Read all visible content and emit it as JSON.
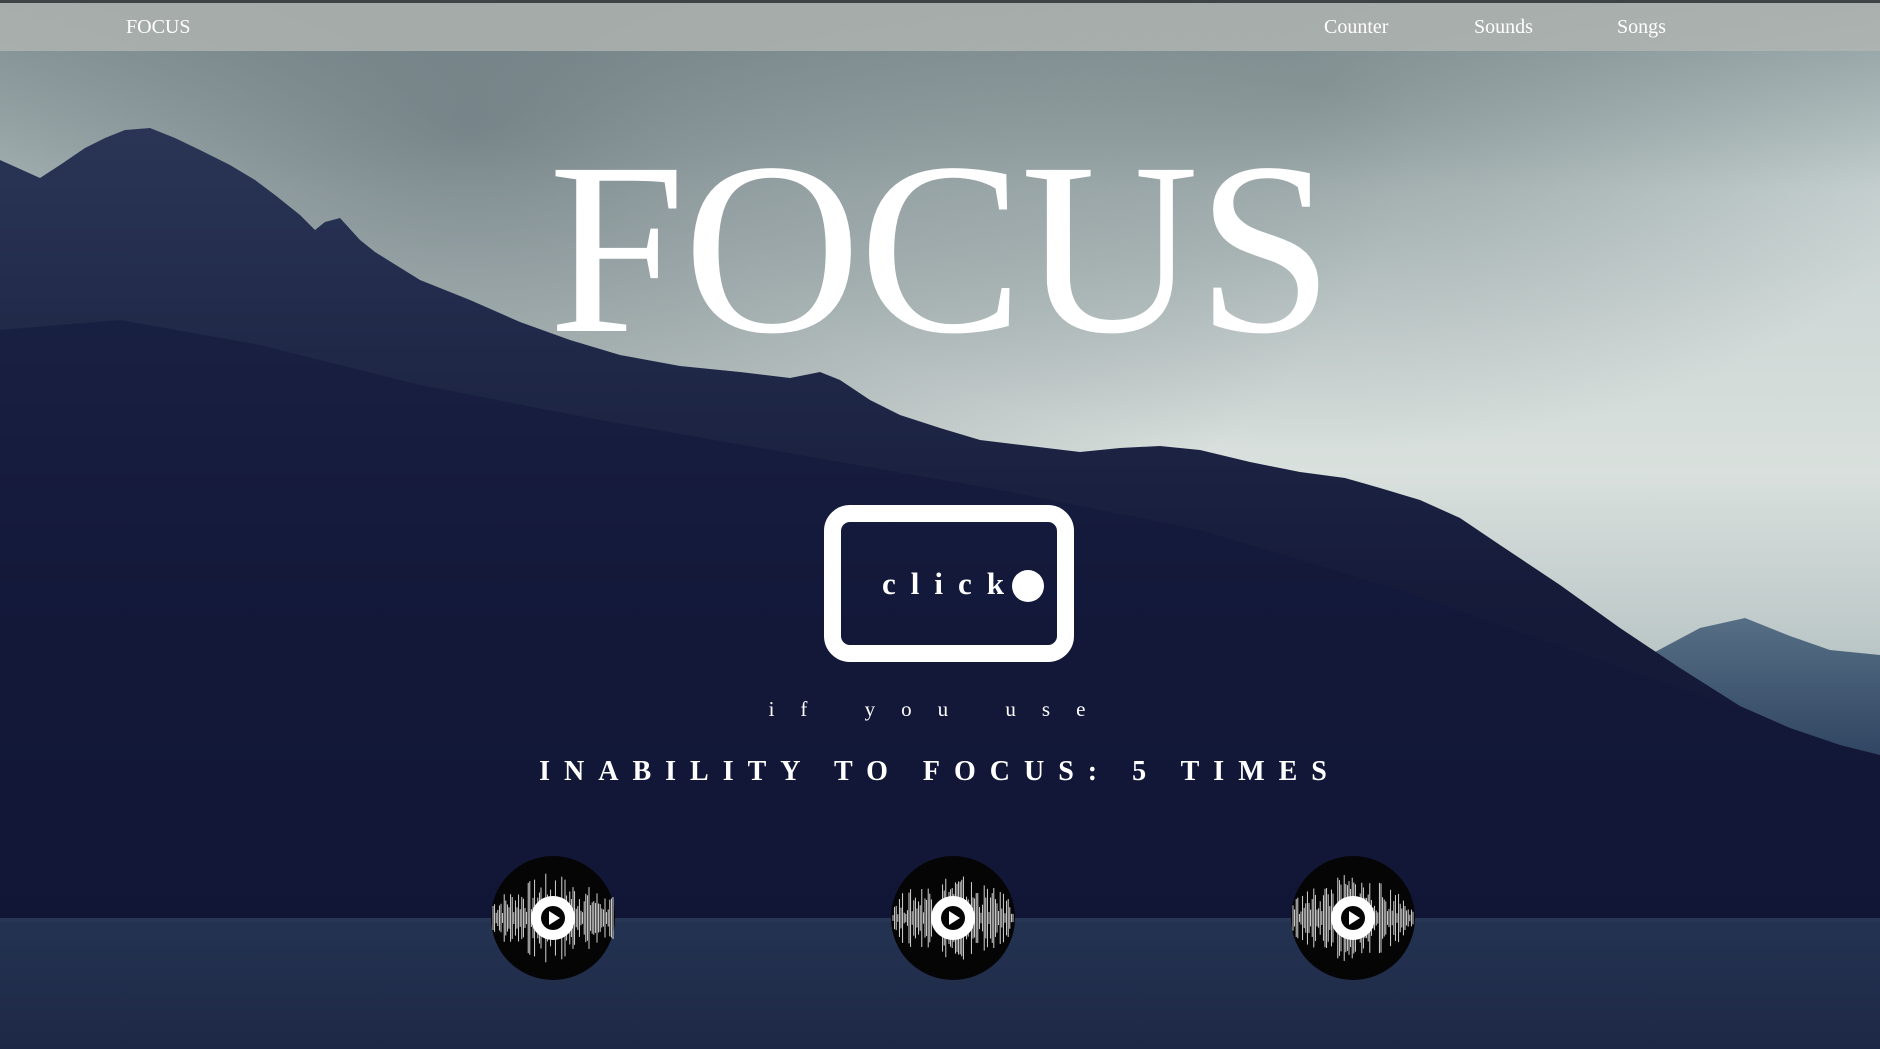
{
  "nav": {
    "brand": "FOCUS",
    "links": [
      "Counter",
      "Sounds",
      "Songs"
    ]
  },
  "hero": {
    "title": "FOCUS",
    "button_label": "click",
    "subline": "if you use",
    "counter_text": "INABILITY TO FOCUS: 5 TIMES"
  },
  "sounds": [
    {
      "icon": "waveform-play-icon"
    },
    {
      "icon": "waveform-play-icon"
    },
    {
      "icon": "waveform-play-icon"
    }
  ],
  "colors": {
    "text": "#ffffff",
    "mountain": "#1a2140",
    "sky": "#c9d3d2",
    "lake": "#1e2b47"
  }
}
